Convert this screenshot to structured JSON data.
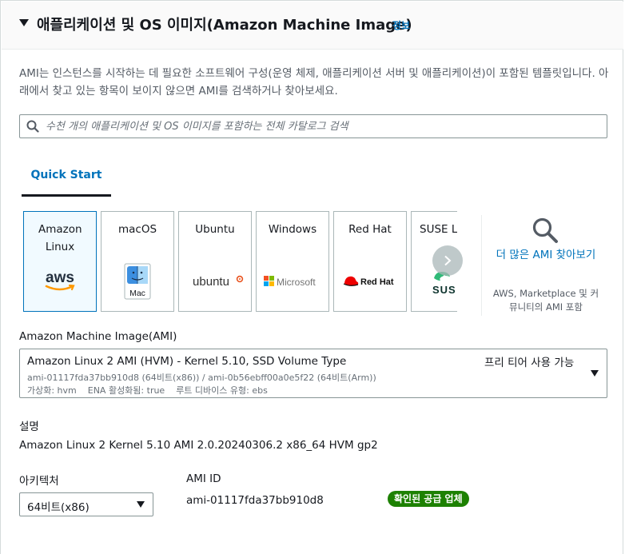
{
  "section": {
    "title": "애플리케이션 및 OS 이미지(Amazon Machine Image)",
    "info_label": "정보",
    "description": "AMI는 인스턴스를 시작하는 데 필요한 소프트웨어 구성(운영 체제, 애플리케이션 서버 및 애플리케이션)이 포함된 템플릿입니다. 아래에서 찾고 있는 항목이 보이지 않으면 AMI를 검색하거나 찾아보세요."
  },
  "search": {
    "placeholder": "수천 개의 애플리케이션 및 OS 이미지를 포함하는 전체 카탈로그 검색",
    "value": ""
  },
  "tabs": [
    {
      "label": "Quick Start",
      "selected": true
    }
  ],
  "os_tiles": [
    {
      "label": "Amazon Linux",
      "logo_text": "aws",
      "icon": "aws-logo-icon",
      "selected": true
    },
    {
      "label": "macOS",
      "logo_text": "Mac",
      "icon": "mac-finder-icon"
    },
    {
      "label": "Ubuntu",
      "logo_text": "ubuntu",
      "icon": "ubuntu-logo-icon"
    },
    {
      "label": "Windows",
      "logo_text": "Microsoft",
      "icon": "microsoft-logo-icon"
    },
    {
      "label": "Red Hat",
      "logo_text": "Red Hat",
      "icon": "redhat-logo-icon"
    },
    {
      "label": "SUSE Li",
      "logo_text": "SUS",
      "icon": "suse-logo-icon"
    }
  ],
  "browse_more": {
    "link": "더 많은 AMI 찾아보기",
    "subtitle": "AWS, Marketplace 및 커뮤니티의 AMI 포함"
  },
  "ami": {
    "label": "Amazon Machine Image(AMI)",
    "name": "Amazon Linux 2 AMI (HVM) - Kernel 5.10, SSD Volume Type",
    "ids": "ami-01117fda37bb910d8 (64비트(x86)) / ami-0b56ebff00a0e5f22 (64비트(Arm))",
    "attributes": "가상화: hvm    ENA 활성화됨: true    루트 디바이스 유형: ebs",
    "free_tier": "프리 티어 사용 가능"
  },
  "description_field": {
    "label": "설명",
    "value": "Amazon Linux 2 Kernel 5.10 AMI 2.0.20240306.2 x86_64 HVM gp2"
  },
  "architecture": {
    "label": "아키텍처",
    "value": "64비트(x86)"
  },
  "ami_id": {
    "label": "AMI ID",
    "value": "ami-01117fda37bb910d8",
    "badge": "확인된 공급 업체"
  },
  "colors": {
    "link": "#0073bb",
    "text": "#16191f",
    "secondary_text": "#545b64",
    "selected_border": "#0073bb",
    "selected_bg": "#f1faff",
    "verified_badge": "#1d8102",
    "aws_orange": "#ff9900",
    "ubuntu_orange": "#e95420",
    "redhat_red": "#ee0000",
    "suse_green": "#30ba78"
  }
}
